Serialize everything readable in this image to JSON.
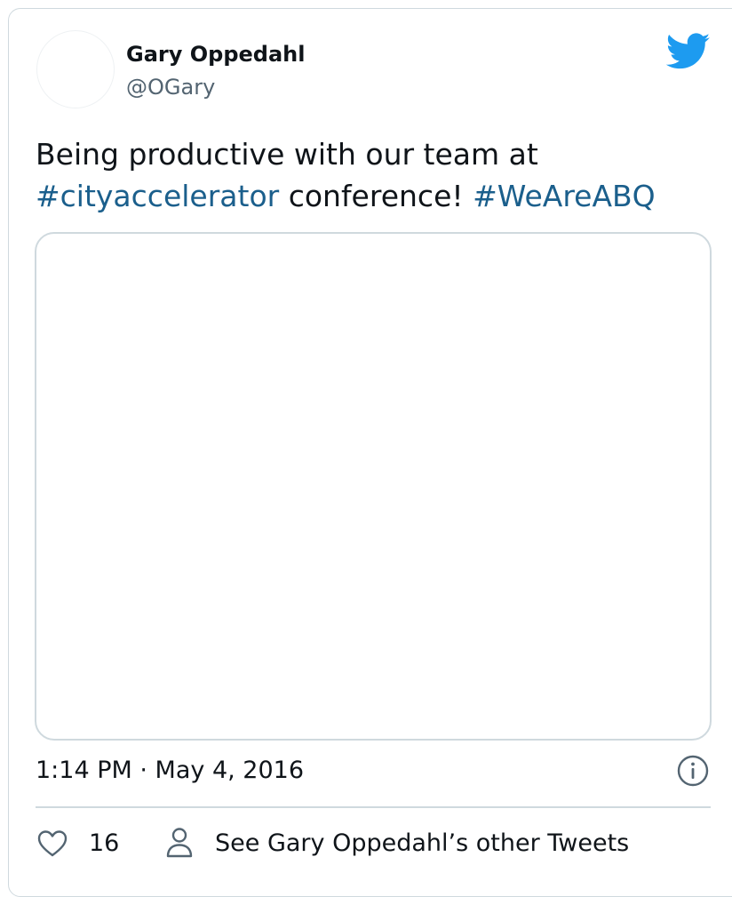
{
  "author": {
    "name": "Gary Oppedahl",
    "handle": "@OGary"
  },
  "tweet": {
    "line1": "Being productive with our team at",
    "hashtag1": "#cityaccelerator",
    "middle": " conference! ",
    "hashtag2": "#WeAreABQ"
  },
  "meta": {
    "timestamp": "1:14 PM · May 4, 2016"
  },
  "actions": {
    "like_count": "16",
    "other_tweets_label": "See Gary Oppedahl’s other Tweets"
  },
  "icons": {
    "brand": "twitter-bird-icon",
    "info": "info-icon",
    "like": "heart-icon",
    "profile": "person-icon"
  },
  "colors": {
    "brand": "#1d9bf0",
    "hashtag": "#1b5f8c",
    "secondary_text": "#536471",
    "border": "#cfd9de"
  }
}
